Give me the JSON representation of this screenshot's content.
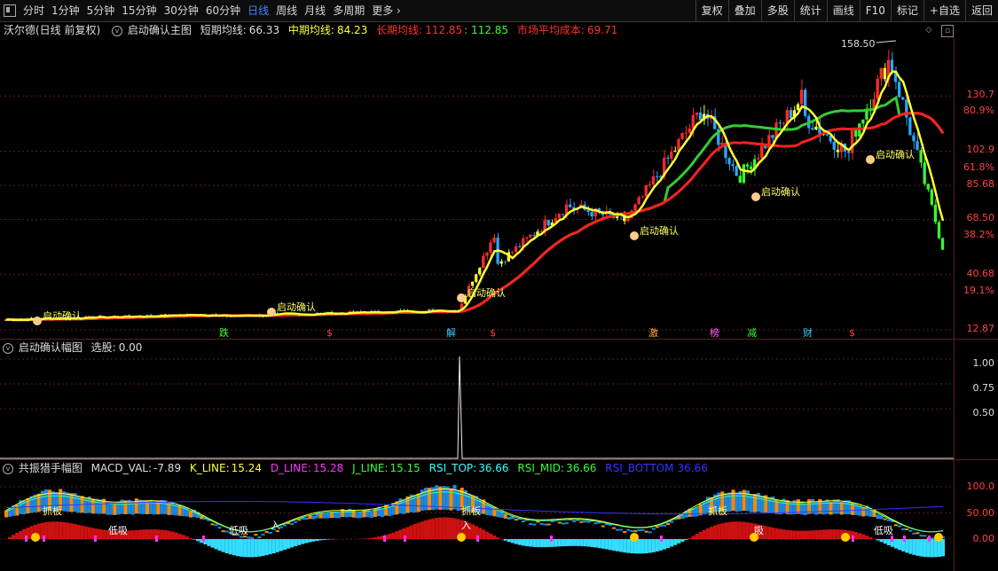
{
  "toolbar": {
    "left_items": [
      {
        "label": "分时",
        "active": false
      },
      {
        "label": "1分钟",
        "active": false
      },
      {
        "label": "5分钟",
        "active": false
      },
      {
        "label": "15分钟",
        "active": false
      },
      {
        "label": "30分钟",
        "active": false
      },
      {
        "label": "60分钟",
        "active": false
      },
      {
        "label": "日线",
        "active": true
      },
      {
        "label": "周线",
        "active": false
      },
      {
        "label": "月线",
        "active": false
      },
      {
        "label": "多周期",
        "active": false
      },
      {
        "label": "更多",
        "active": false
      }
    ],
    "right_items": [
      "复权",
      "叠加",
      "多股",
      "统计",
      "画线",
      "F10",
      "标记",
      "+自选",
      "返回"
    ]
  },
  "main_panel": {
    "stock_name": "沃尔德(日线 前复权)",
    "indicator_name": "启动确认主图",
    "short_ma_label": "短期均线:",
    "short_ma_value": "66.33",
    "mid_ma_label": "中期均线:",
    "mid_ma_value": "84.23",
    "long_ma_label": "长期均线:",
    "long_ma_value": "112.85",
    "long_ma_value2": ": 112.85",
    "avg_cost_label": "市场平均成本:",
    "avg_cost_value": "69.71",
    "high_label": "158.50",
    "signal_label": "启动确认",
    "axis_prices": [
      "130.7",
      "102.9",
      "85.68",
      "68.50",
      "40.68",
      "12.87"
    ],
    "axis_percents": [
      "80.9%",
      "61.8%",
      "38.2%",
      "19.1%"
    ],
    "event_marks": [
      "跌",
      "$",
      "解",
      "$",
      "激",
      "榜",
      "减",
      "财",
      "$"
    ]
  },
  "sub_panel1": {
    "title": "启动确认幅图",
    "select_label": "选股:",
    "select_value": "0.00",
    "axis": [
      "1.00",
      "0.75",
      "0.50"
    ]
  },
  "sub_panel2": {
    "title": "共振猎手幅图",
    "macd_label": "MACD_VAL:",
    "macd_value": "-7.89",
    "k_label": "K_LINE:",
    "k_value": "15.24",
    "d_label": "D_LINE:",
    "d_value": "15.28",
    "j_label": "J_LINE:",
    "j_value": "15.15",
    "rsi_top_label": "RSI_TOP:",
    "rsi_top_value": "36.66",
    "rsi_mid_label": "RSI_MID:",
    "rsi_mid_value": "36.66",
    "rsi_bottom_label": "RSI_BOTTOM",
    "rsi_bottom_value": "36.66",
    "axis": [
      "100.0",
      "50.00",
      "0.00"
    ],
    "tags": [
      "抓板",
      "低吸",
      "入",
      "吸"
    ]
  },
  "colors": {
    "up": "#ff2a2a",
    "down": "#2aa8ff",
    "short_ma": "#ffff33",
    "mid_ma": "#33ff33",
    "long_ma": "#ff2020",
    "signal": "#ffd24d"
  }
}
